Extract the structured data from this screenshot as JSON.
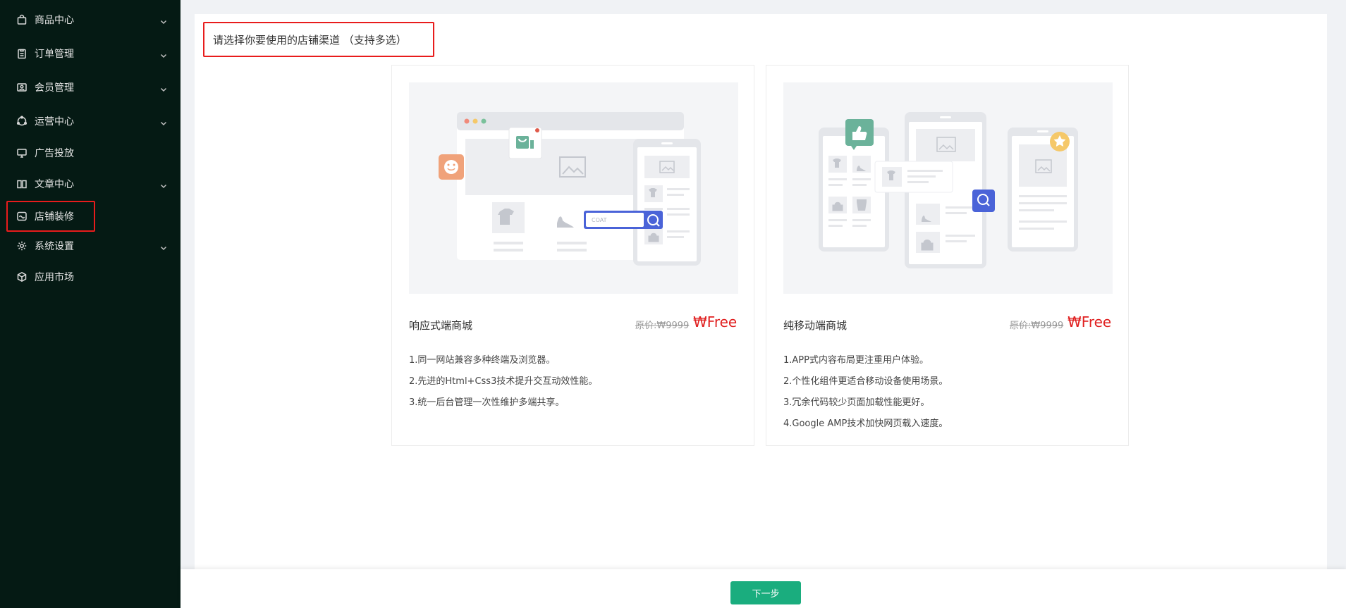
{
  "sidebar": {
    "items": [
      {
        "label": "商品中心",
        "icon": "bag-icon",
        "has_arrow": true
      },
      {
        "label": "订单管理",
        "icon": "clipboard-icon",
        "has_arrow": true
      },
      {
        "label": "会员管理",
        "icon": "member-card-icon",
        "has_arrow": true
      },
      {
        "label": "运营中心",
        "icon": "operations-icon",
        "has_arrow": true
      },
      {
        "label": "广告投放",
        "icon": "monitor-icon",
        "has_arrow": false
      },
      {
        "label": "文章中心",
        "icon": "book-icon",
        "has_arrow": true
      },
      {
        "label": "店铺装修",
        "icon": "storefront-icon",
        "has_arrow": false
      },
      {
        "label": "系统设置",
        "icon": "gear-icon",
        "has_arrow": true
      },
      {
        "label": "应用市场",
        "icon": "cube-icon",
        "has_arrow": false
      }
    ]
  },
  "main": {
    "heading": "请选择你要使用的店铺渠道 （支持多选）",
    "cards": [
      {
        "title": "响应式端商城",
        "original_price": "原价:₩9999",
        "price": "₩Free",
        "features": [
          "1.同一网站兼容多种终端及浏览器。",
          "2.先进的Html+Css3技术提升交互动效性能。",
          "3.统一后台管理一次性维护多端共享。"
        ],
        "search_text": "COAT"
      },
      {
        "title": "纯移动端商城",
        "original_price": "原价:₩9999",
        "price": "₩Free",
        "features": [
          "1.APP式内容布局更注重用户体验。",
          "2.个性化组件更适合移动设备使用场景。",
          "3.冗余代码较少页面加载性能更好。",
          "4.Google AMP技术加快网页载入速度。"
        ]
      }
    ]
  },
  "footer": {
    "next_label": "下一步"
  },
  "colors": {
    "sidebar_bg": "#051a14",
    "accent": "#1aad7e",
    "price": "#e02020",
    "highlight": "#e81c1c",
    "illus_blue": "#4a63d8"
  }
}
